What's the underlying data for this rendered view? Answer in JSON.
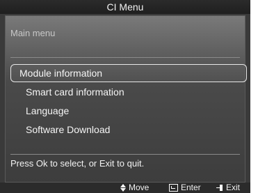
{
  "window": {
    "title": "CI Menu"
  },
  "panel": {
    "section_title": "Main menu"
  },
  "menu": {
    "items": [
      {
        "label": "Module information"
      },
      {
        "label": "Smart card information"
      },
      {
        "label": "Language"
      },
      {
        "label": "Software Download"
      }
    ],
    "selected_index": 0
  },
  "hint": "Press Ok to select, or Exit to quit.",
  "footer": {
    "move_label": "Move",
    "enter_label": "Enter",
    "exit_label": "Exit",
    "move_icon": "up-down-arrows-icon",
    "enter_icon": "enter-icon",
    "exit_icon": "exit-icon"
  }
}
